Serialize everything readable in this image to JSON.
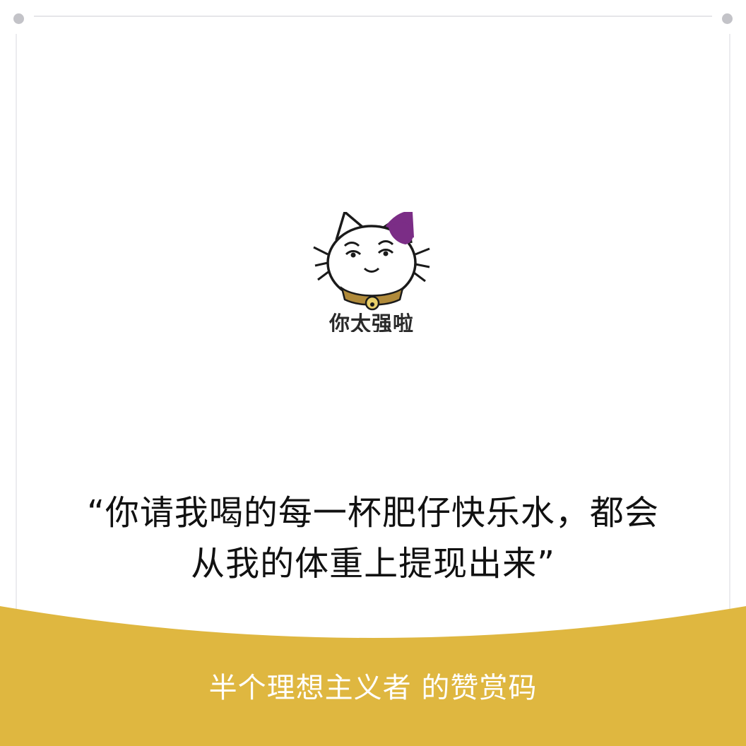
{
  "sticker": {
    "caption": "你太强啦",
    "icon": "cat-sticker-icon"
  },
  "quote": {
    "line1": "“你请我喝的每一杯肥仔快乐水，都会",
    "line2": "从我的体重上提现出来”"
  },
  "footer": {
    "label": "半个理想主义者 的赞赏码"
  },
  "colors": {
    "band": "#dfb740",
    "cat_patch": "#7b2d86",
    "collar": "#b08a3a",
    "rail_dot": "#c3c3c8"
  }
}
